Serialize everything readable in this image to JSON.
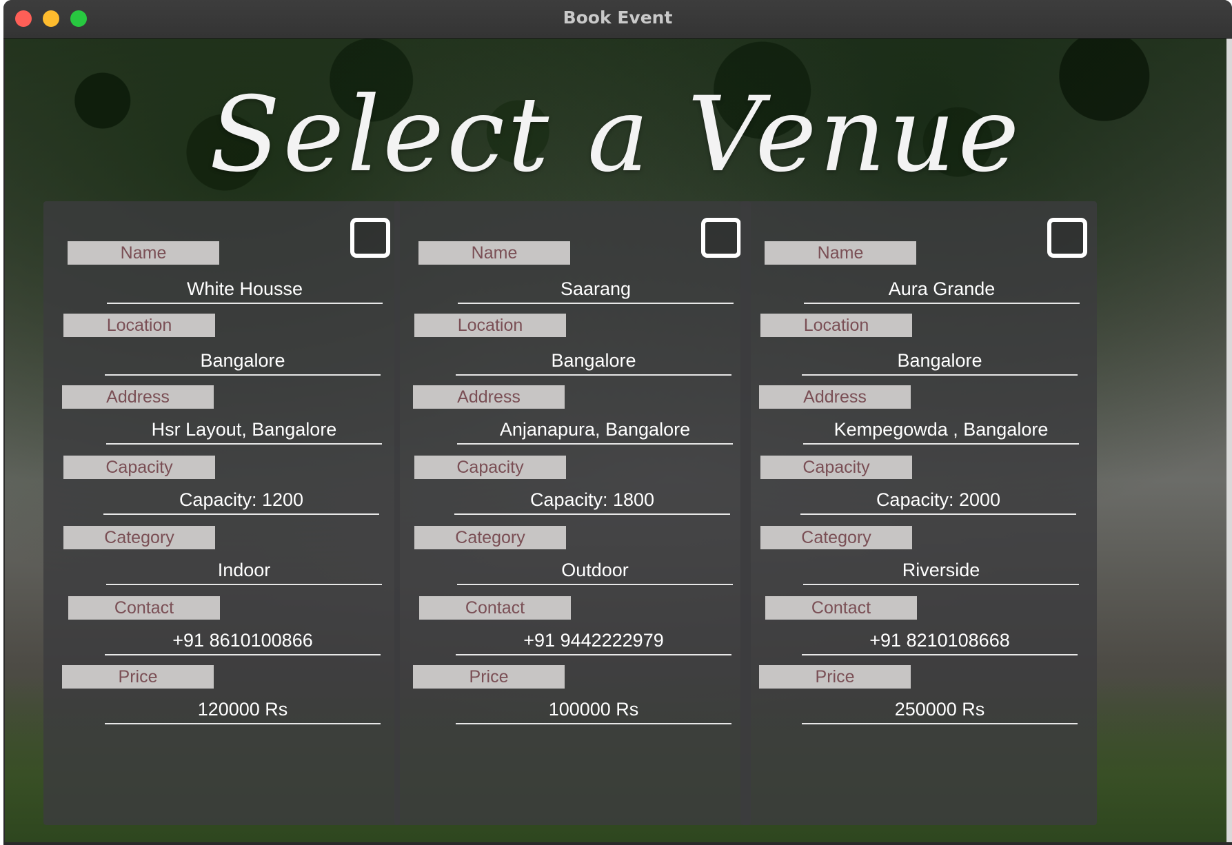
{
  "window": {
    "title": "Book Event"
  },
  "headline": "Select a Venue",
  "field_labels": {
    "name": "Name",
    "location": "Location",
    "address": "Address",
    "capacity": "Capacity",
    "category": "Category",
    "contact": "Contact",
    "price": "Price"
  },
  "venues": [
    {
      "selected": false,
      "name": "White Housse",
      "location": "Bangalore",
      "address": "Hsr Layout, Bangalore",
      "capacity": "Capacity: 1200",
      "category": "Indoor",
      "contact": "+91  8610100866",
      "price": "120000 Rs"
    },
    {
      "selected": false,
      "name": "Saarang",
      "location": "Bangalore",
      "address": "Anjanapura, Bangalore",
      "capacity": "Capacity: 1800",
      "category": "Outdoor",
      "contact": "+91  9442222979",
      "price": "100000 Rs"
    },
    {
      "selected": false,
      "name": "Aura Grande",
      "location": "Bangalore",
      "address": "Kempegowda , Bangalore",
      "capacity": "Capacity: 2000",
      "category": "Riverside",
      "contact": "+91  8210108668",
      "price": "250000 Rs"
    }
  ],
  "colors": {
    "label_bg": "#c7c5c4",
    "label_text": "#7a4f55",
    "value_text": "#ffffff",
    "card_bg": "rgba(60,60,62,0.82)"
  }
}
